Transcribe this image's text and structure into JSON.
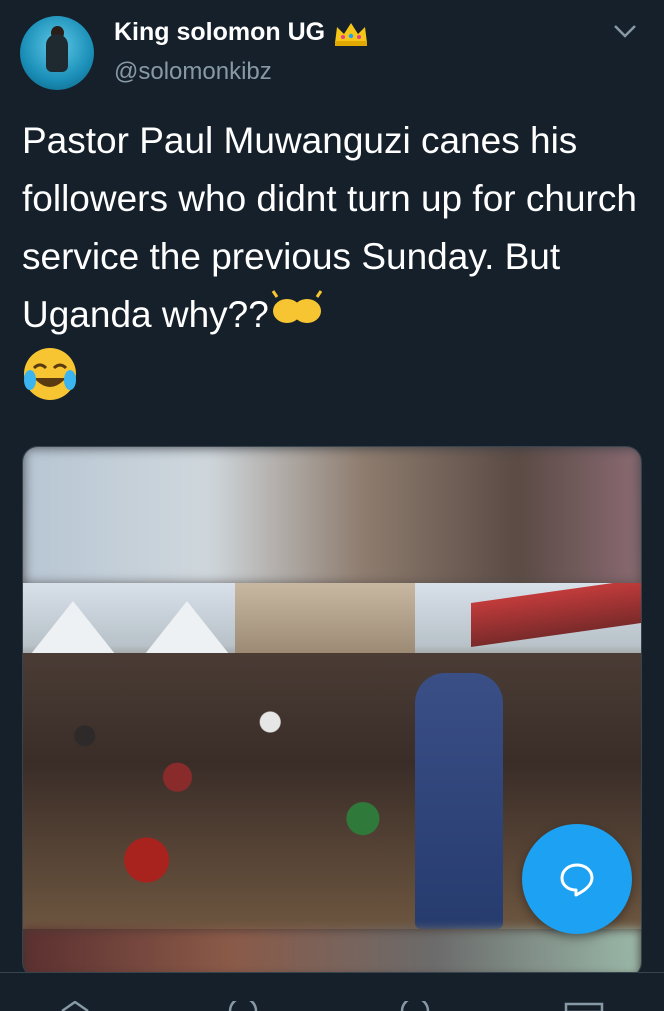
{
  "tweet": {
    "display_name": "King solomon UG",
    "handle": "@solomonkibz",
    "text": "Pastor Paul Muwanguzi canes his followers who didnt turn up for church service the previous Sunday. But Uganda why??",
    "emojis": [
      "raised-hands-emoji",
      "tears-of-joy-emoji"
    ],
    "badge_icon": "crown-icon"
  },
  "header": {
    "menu_icon": "chevron-down-icon"
  },
  "media": {
    "type": "video-thumbnail"
  },
  "fab": {
    "icon": "compose-reply-icon",
    "color": "#1da1f2"
  },
  "bottom_nav": {
    "items": [
      "home-icon",
      "search-icon",
      "notifications-icon",
      "messages-icon"
    ]
  },
  "colors": {
    "background": "#15202b",
    "secondary_text": "#8899a6",
    "accent": "#1da1f2"
  }
}
